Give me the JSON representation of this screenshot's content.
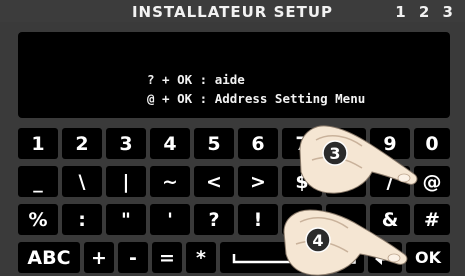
{
  "header": {
    "title": "INSTALLATEUR  SETUP",
    "page_indicator": "1 2 3"
  },
  "display": {
    "line1": "? + OK : aide",
    "line2": "@ + OK : Address Setting Menu"
  },
  "keyboard": {
    "row1": [
      "1",
      "2",
      "3",
      "4",
      "5",
      "6",
      "7",
      "8",
      "9",
      "0"
    ],
    "row2": [
      "_",
      "\\",
      "|",
      "~",
      "<",
      ">",
      "$",
      "",
      "/",
      "@"
    ],
    "row3": [
      "%",
      ":",
      "\"",
      "'",
      "?",
      "!",
      "",
      "",
      "&",
      "#"
    ],
    "row4": {
      "abc": "ABC",
      "plus": "+",
      "minus": "-",
      "equals": "=",
      "star": "*",
      "ok": "OK"
    }
  },
  "callouts": {
    "step3": "3",
    "step4": "4"
  },
  "icons": {
    "space": "space-icon",
    "backspace": "backspace-icon",
    "enter": "enter-icon",
    "hand": "hand-icon"
  }
}
